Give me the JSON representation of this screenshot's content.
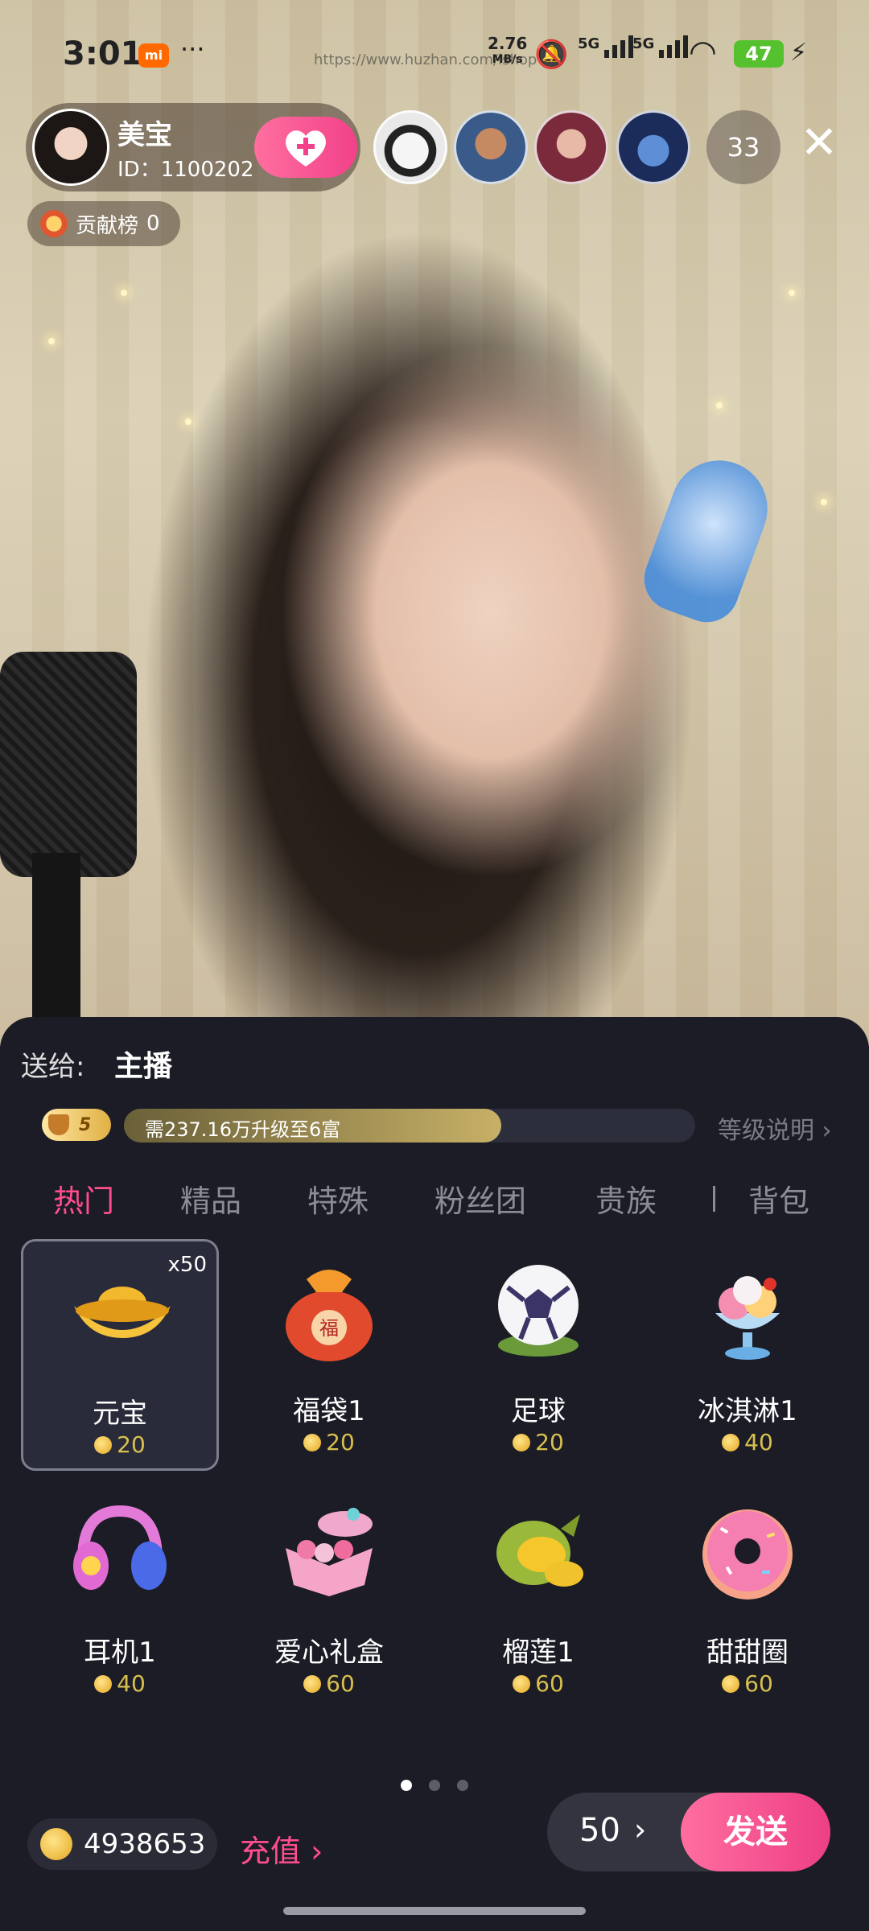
{
  "status_bar": {
    "time": "3:01",
    "brand": "mi",
    "more": "···",
    "url": "https://www.huzhan.com/ishop",
    "net_speed": "2.76",
    "net_unit": "MB/s",
    "sig1_label": "5G",
    "sig2_label": "5G",
    "battery": "47"
  },
  "anchor": {
    "name": "美宝",
    "id": "ID：1100202",
    "viewer_count": "33"
  },
  "contribution": {
    "label": "贡献榜",
    "value": "0"
  },
  "send_to": {
    "label": "送给:",
    "target": "主播"
  },
  "level": {
    "current": "5",
    "progress_text": "需237.16万升级至6富",
    "progress": 0.66,
    "explain": "等级说明 ›"
  },
  "tabs": [
    {
      "label": "热门",
      "active": true
    },
    {
      "label": "精品",
      "active": false
    },
    {
      "label": "特殊",
      "active": false
    },
    {
      "label": "粉丝团",
      "active": false
    },
    {
      "label": "贵族",
      "active": false
    },
    {
      "label": "背包",
      "active": false
    }
  ],
  "gifts": [
    {
      "name": "元宝",
      "price": "20",
      "multiplier": "x50",
      "icon": "gold-ingot-icon",
      "selected": true
    },
    {
      "name": "福袋1",
      "price": "20",
      "icon": "lucky-bag-icon"
    },
    {
      "name": "足球",
      "price": "20",
      "icon": "soccer-ball-icon"
    },
    {
      "name": "冰淇淋1",
      "price": "40",
      "icon": "ice-cream-icon"
    },
    {
      "name": "耳机1",
      "price": "40",
      "icon": "headphones-icon"
    },
    {
      "name": "爱心礼盒",
      "price": "60",
      "icon": "gift-box-icon"
    },
    {
      "name": "榴莲1",
      "price": "60",
      "icon": "durian-icon"
    },
    {
      "name": "甜甜圈",
      "price": "60",
      "icon": "donut-icon"
    }
  ],
  "pager": {
    "pages": 3,
    "current": 0
  },
  "wallet": {
    "balance": "4938653",
    "recharge": "充值 ›"
  },
  "send": {
    "quantity": "50",
    "arrow": "›",
    "button": "发送"
  },
  "colors": {
    "accent": "#ff4d8d",
    "panel_bg": "#1b1c25",
    "price": "#d8c04e"
  }
}
